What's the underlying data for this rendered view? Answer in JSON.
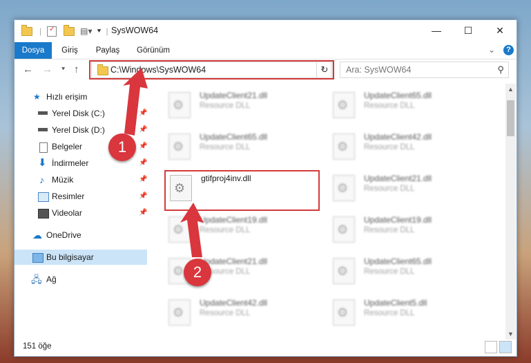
{
  "window": {
    "title": "SysWOW64",
    "controls": {
      "minimize": "—",
      "maximize": "☐",
      "close": "✕"
    }
  },
  "ribbon": {
    "tabs": [
      "Dosya",
      "Giriş",
      "Paylaş",
      "Görünüm"
    ],
    "help": "?",
    "collapse": "⌄"
  },
  "address": {
    "path": "C:\\Windows\\SysWOW64",
    "search_placeholder": "Ara: SysWOW64"
  },
  "nav_pane": {
    "quick_access": "Hızlı erişim",
    "pinned": [
      "Yerel Disk (C:)",
      "Yerel Disk (D:)",
      "Belgeler",
      "İndirmeler",
      "Müzik",
      "Resimler",
      "Videolar"
    ],
    "onedrive": "OneDrive",
    "this_pc": "Bu bilgisayar",
    "network": "Ağ"
  },
  "files": [
    {
      "name": "UpdateClient21.dll",
      "desc": "Resource DLL"
    },
    {
      "name": "UpdateClient65.dll",
      "desc": "Resource DLL"
    },
    {
      "name": "UpdateClient65.dll",
      "desc": "Resource DLL"
    },
    {
      "name": "UpdateClient42.dll",
      "desc": "Resource DLL"
    },
    {
      "name": "gtifproj4inv.dll",
      "desc": ""
    },
    {
      "name": "UpdateClient21.dll",
      "desc": "Resource DLL"
    },
    {
      "name": "UpdateClient19.dll",
      "desc": "Resource DLL"
    },
    {
      "name": "UpdateClient19.dll",
      "desc": "Resource DLL"
    },
    {
      "name": "UpdateClient21.dll",
      "desc": "Resource DLL"
    },
    {
      "name": "UpdateClient65.dll",
      "desc": "Resource DLL"
    },
    {
      "name": "UpdateClient42.dll",
      "desc": "Resource DLL"
    },
    {
      "name": "UpdateClient5.dll",
      "desc": "Resource DLL"
    }
  ],
  "status": {
    "count": "151 öğe"
  },
  "callouts": [
    "1",
    "2"
  ],
  "colors": {
    "accent": "#1979ca",
    "highlight": "#d23a3a",
    "selection": "#cce4f7"
  }
}
